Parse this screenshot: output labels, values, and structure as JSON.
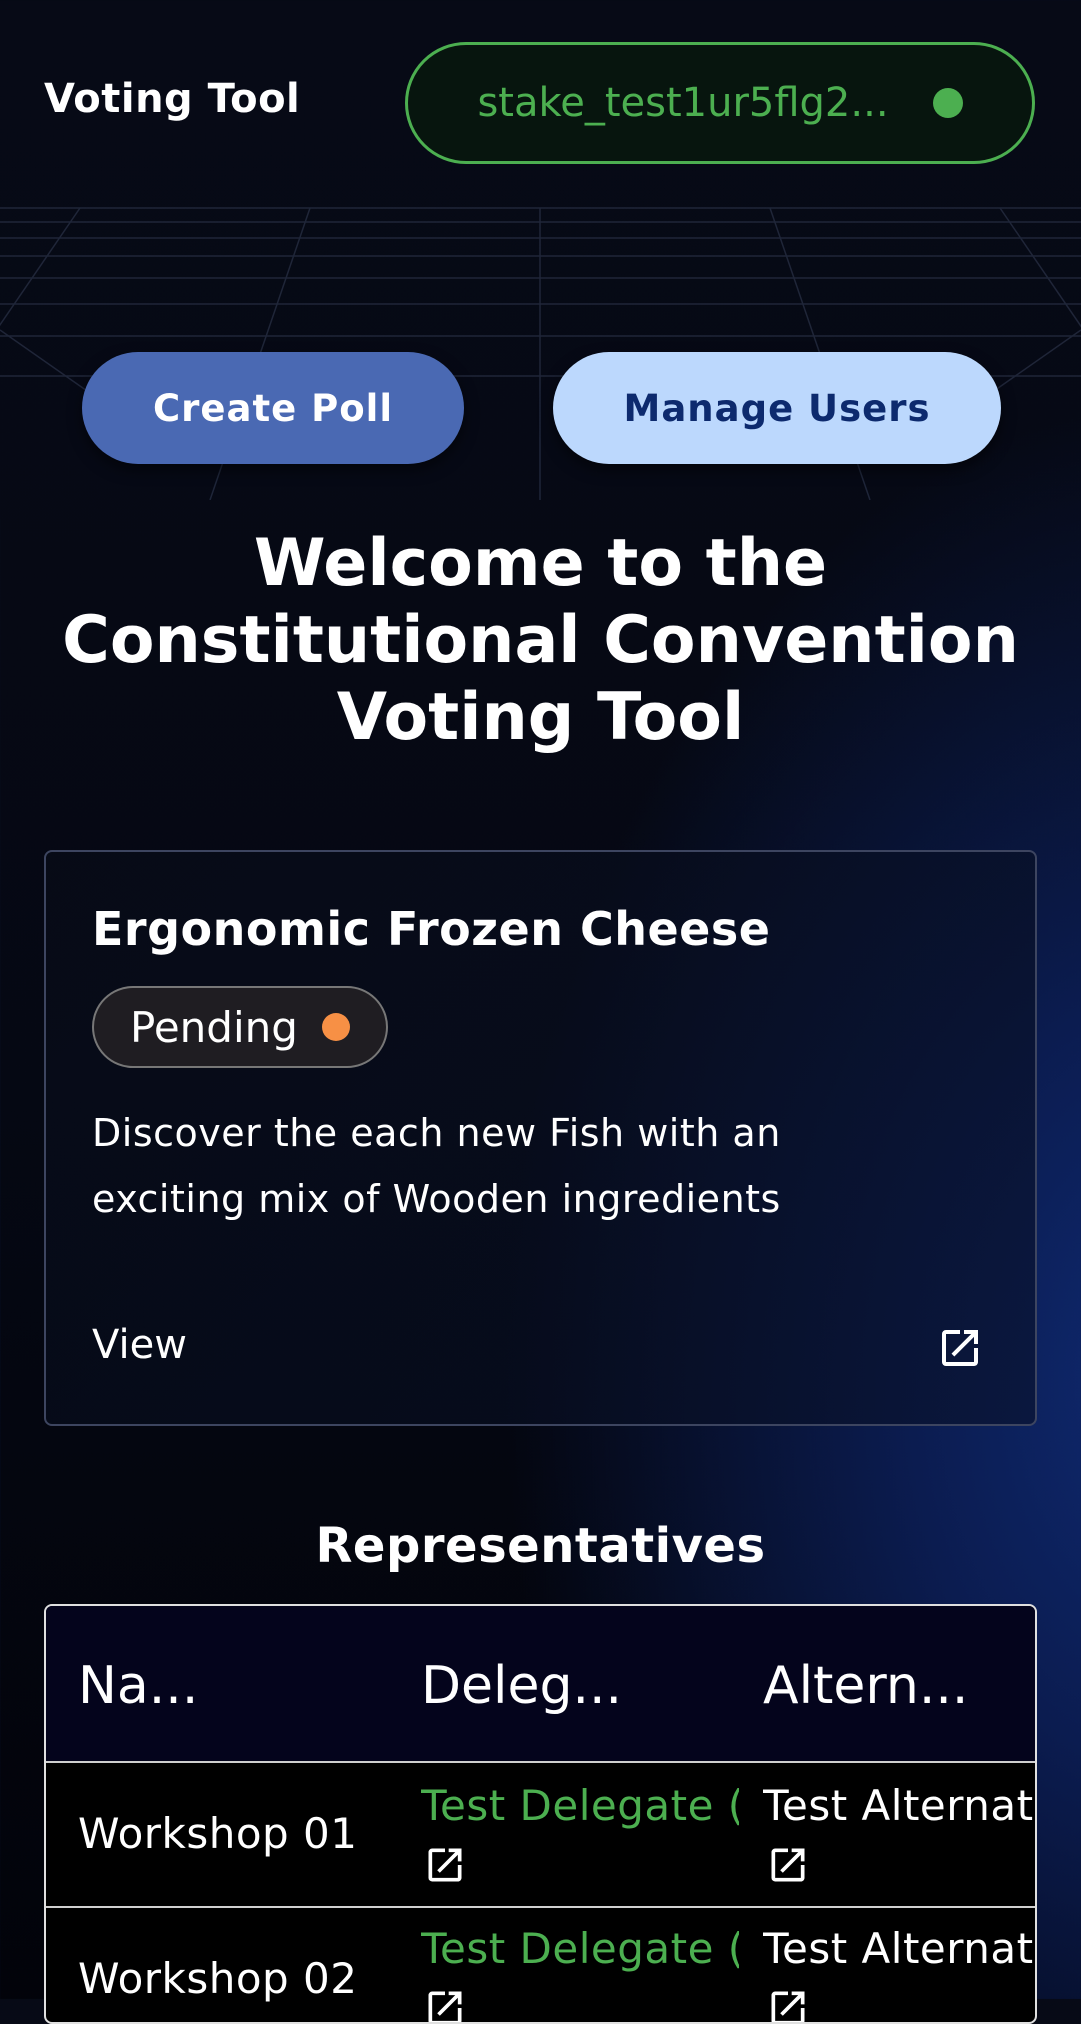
{
  "header": {
    "app_title": "Voting Tool",
    "wallet_address": "stake_test1ur5flg2...",
    "wallet_status_color": "#4caf50"
  },
  "actions": {
    "create_poll": "Create Poll",
    "manage_users": "Manage Users"
  },
  "welcome": {
    "line1": "Welcome to the",
    "line2": "Constitutional Convention",
    "line3": "Voting Tool"
  },
  "poll_card": {
    "title": "Ergonomic Frozen Cheese",
    "status": "Pending",
    "status_color": "#f79045",
    "description": "Discover the each new Fish with an exciting mix of Wooden ingredients",
    "view_label": "View",
    "view_icon": "external-link-icon"
  },
  "representatives": {
    "title": "Representatives",
    "columns": [
      "Na...",
      "Deleg...",
      "Altern..."
    ],
    "rows": [
      {
        "name": "Workshop 01",
        "delegate": "Test Delegate (",
        "alternate": "Test Alternat"
      },
      {
        "name": "Workshop 02",
        "delegate": "Test Delegate (",
        "alternate": "Test Alternat"
      }
    ]
  },
  "colors": {
    "accent_green": "#4caf50",
    "primary_button": "#4a69b3",
    "secondary_button": "#bcd8fd"
  }
}
